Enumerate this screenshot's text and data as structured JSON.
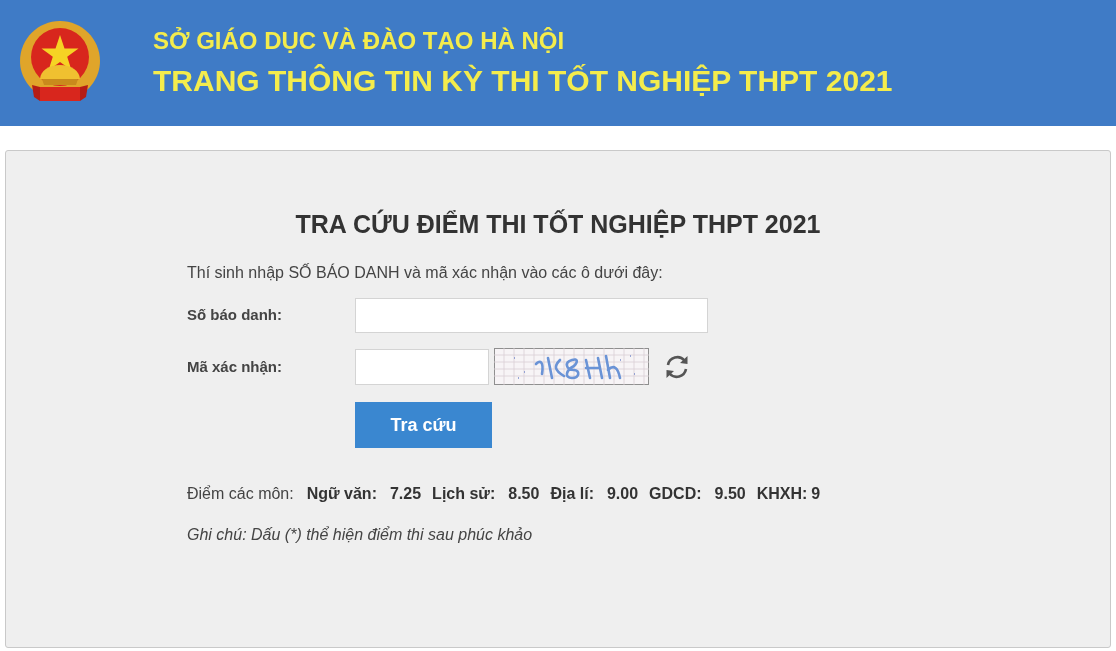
{
  "header": {
    "subtitle": "SỞ GIÁO DỤC VÀ ĐÀO TẠO HÀ NỘI",
    "title": "TRANG THÔNG TIN KỲ THI TỐT NGHIỆP THPT 2021"
  },
  "lookup_panel": {
    "title": "TRA CỨU ĐIỂM THI TỐT NGHIỆP THPT 2021",
    "instruction": "Thí sinh nhập SỐ BÁO DANH và mã xác nhận vào các ô dưới đây:",
    "fields": [
      {
        "kind": "text",
        "label": "Số báo danh:"
      },
      {
        "kind": "captcha",
        "label": "Mã xác nhận:"
      }
    ],
    "submit_button": "Tra cứu",
    "results": {
      "label": "Điểm các môn:",
      "scores": [
        {
          "subject": "Ngữ văn:",
          "score": "7.25"
        },
        {
          "subject": "Lịch sử:",
          "score": "8.50"
        },
        {
          "subject": "Địa lí:",
          "score": "9.00"
        },
        {
          "subject": "GDCD:",
          "score": "9.50"
        },
        {
          "subject": "KHXH:",
          "score": "9"
        }
      ]
    },
    "note": "Ghi chú: Dấu (*) thể hiện điểm thi sau phúc khảo"
  }
}
